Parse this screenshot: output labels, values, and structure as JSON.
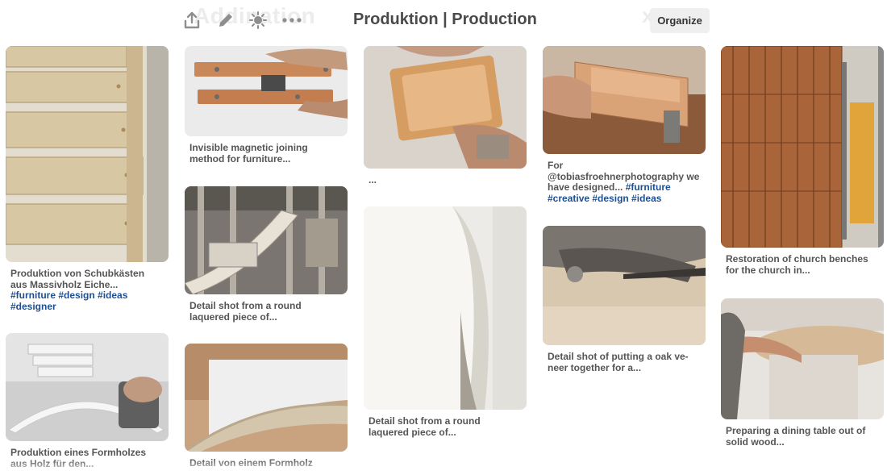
{
  "header": {
    "faint_title": "Addination",
    "faint_right": "x",
    "board_title": "Produktion | Production",
    "organize_label": "Organize",
    "tools": [
      "upload-icon",
      "pencil-icon",
      "sparkle-icon",
      "more-icon"
    ]
  },
  "pins": [
    {
      "desc_pre": "Produktion von Schubkästen aus Massivholz Eiche... ",
      "tags": "#furniture #design #ideas #designer"
    },
    {
      "desc_pre": "Produktion eines Formholzes aus Holz für den...",
      "tags": ""
    },
    {
      "desc_pre": "Invisible magnetic joining method for furniture...",
      "tags": ""
    },
    {
      "desc_pre": "Detail shot from a round laquered piece of...",
      "tags": ""
    },
    {
      "desc_pre": "Detail von einem Formholz",
      "tags": ""
    },
    {
      "desc_pre": "...",
      "tags": ""
    },
    {
      "desc_pre": "Detail shot from a round laquered piece of...",
      "tags": ""
    },
    {
      "desc_pre": "For @tobiasfroehnerphotography we have designed... ",
      "tags": "#furniture #creative #design #ideas"
    },
    {
      "desc_pre": "Detail shot of putting a oak ve-neer together for a...",
      "tags": ""
    },
    {
      "desc_pre": "Restoration of church benches for the church in...",
      "tags": ""
    },
    {
      "desc_pre": "Preparing a dining table out of solid wood...",
      "tags": ""
    }
  ]
}
